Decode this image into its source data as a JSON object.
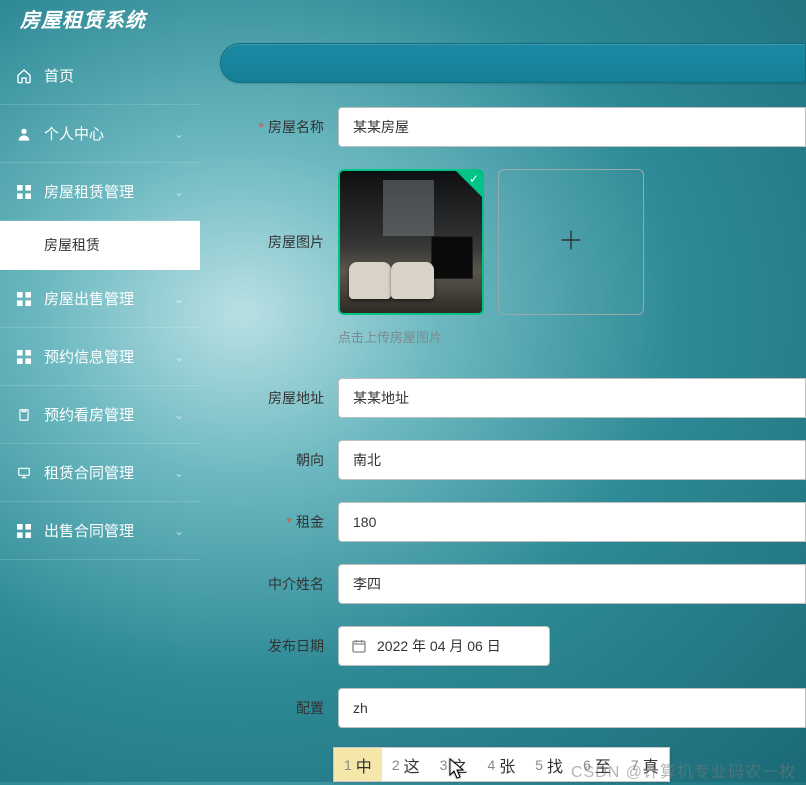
{
  "app": {
    "title": "房屋租赁系统"
  },
  "sidebar": {
    "items": [
      {
        "label": "首页",
        "icon": "home-icon",
        "expand": false
      },
      {
        "label": "个人中心",
        "icon": "user-icon",
        "expand": true
      },
      {
        "label": "房屋租赁管理",
        "icon": "grid-icon",
        "expand": true
      },
      {
        "label": "房屋出售管理",
        "icon": "grid-icon",
        "expand": true
      },
      {
        "label": "预约信息管理",
        "icon": "grid-icon",
        "expand": true
      },
      {
        "label": "预约看房管理",
        "icon": "clipboard-icon",
        "expand": true
      },
      {
        "label": "租赁合同管理",
        "icon": "monitor-icon",
        "expand": true
      },
      {
        "label": "出售合同管理",
        "icon": "grid-icon",
        "expand": true
      }
    ],
    "sub_item": "房屋租赁"
  },
  "form": {
    "labels": {
      "name": "房屋名称",
      "image": "房屋图片",
      "address": "房屋地址",
      "orientation": "朝向",
      "rent": "租金",
      "agent": "中介姓名",
      "date": "发布日期",
      "config": "配置"
    },
    "values": {
      "name": "某某房屋",
      "address": "某某地址",
      "orientation": "南北",
      "rent": "180",
      "agent": "李四",
      "date": "2022 年 04 月 06 日",
      "config": "zh"
    },
    "upload_hint": "点击上传房屋图片"
  },
  "ime": {
    "candidates": [
      {
        "n": "1",
        "w": "中"
      },
      {
        "n": "2",
        "w": "这"
      },
      {
        "n": "3",
        "w": "之"
      },
      {
        "n": "4",
        "w": "张"
      },
      {
        "n": "5",
        "w": "找"
      },
      {
        "n": "6",
        "w": "至"
      },
      {
        "n": "7",
        "w": "真"
      }
    ]
  },
  "watermark": "CSDN @计算机专业码农一枚"
}
